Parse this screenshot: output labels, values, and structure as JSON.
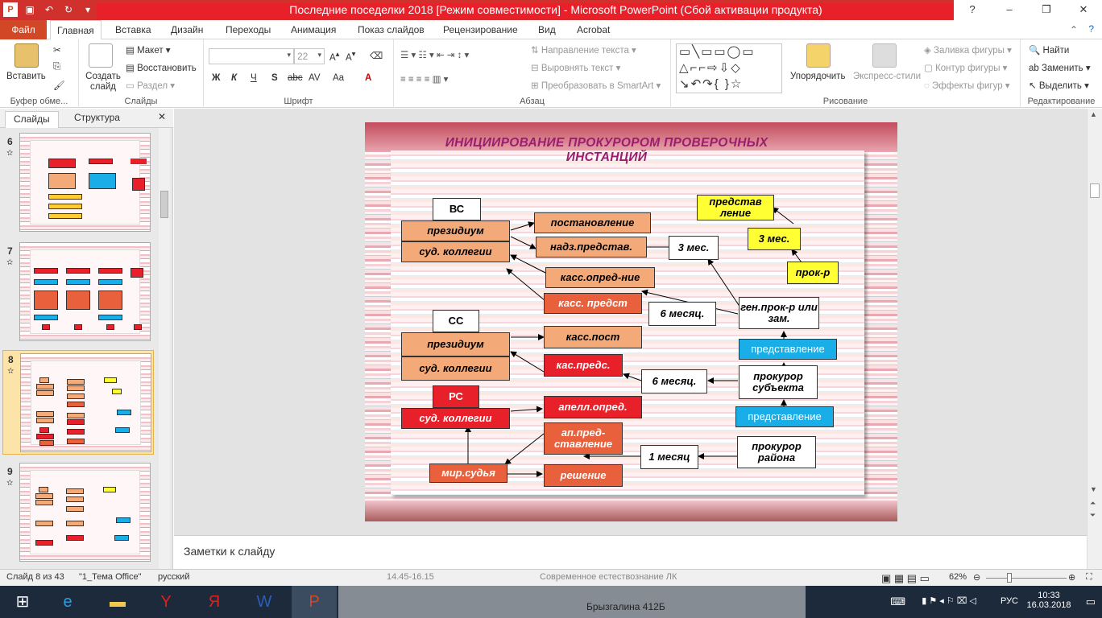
{
  "titlebar": {
    "title": "Последние поседелки 2018 [Режим совместимости] - Microsoft PowerPoint (Сбой активации продукта)"
  },
  "tabs": [
    "Файл",
    "Главная",
    "Вставка",
    "Дизайн",
    "Переходы",
    "Анимация",
    "Показ слайдов",
    "Рецензирование",
    "Вид",
    "Acrobat"
  ],
  "ribbon": {
    "clipboard": {
      "paste": "Вставить",
      "label": "Буфер обме..."
    },
    "slides": {
      "new_slide": "Создать слайд",
      "layout": "Макет",
      "reset": "Восстановить",
      "section": "Раздел",
      "label": "Слайды"
    },
    "font": {
      "size": "22",
      "label": "Шрифт",
      "bold": "Ж",
      "italic": "К",
      "underline": "Ч",
      "strike": "S",
      "shadow": "abc",
      "spacing": "AV",
      "case": "Aa"
    },
    "paragraph": {
      "text_dir": "Направление текста",
      "align_text": "Выровнять текст",
      "smartart": "Преобразовать в SmartArt",
      "label": "Абзац"
    },
    "drawing": {
      "arrange": "Упорядочить",
      "quick_styles": "Экспресс-стили",
      "fill": "Заливка фигуры",
      "outline": "Контур фигуры",
      "effects": "Эффекты фигур",
      "label": "Рисование"
    },
    "editing": {
      "find": "Найти",
      "replace": "Заменить",
      "select": "Выделить",
      "label": "Редактирование"
    }
  },
  "left_panel": {
    "tab_slides": "Слайды",
    "tab_outline": "Структура",
    "thumbs": [
      {
        "num": "6"
      },
      {
        "num": "7"
      },
      {
        "num": "8"
      },
      {
        "num": "9"
      }
    ]
  },
  "slide": {
    "title_line1": "ИНИЦИИРОВАНИЕ   ПРОКУРОРОМ  ПРОВЕРОЧНЫХ",
    "title_line2": "ИНСТАНЦИЙ",
    "vs": "ВС",
    "vs_pres": "президиум",
    "vs_kol": "суд. коллегии",
    "postanov": "постановление",
    "nadz": "надз.представ.",
    "kass_opr": "касс.опред-ние",
    "kass_predst": "касс.  предст",
    "ss": "СС",
    "ss_pres": "президиум",
    "ss_kol": "суд. коллегии",
    "kass_post": "касс.пост",
    "kas_preds": "кас.предс.",
    "rs": "РС",
    "rs_kol": "суд. коллегии",
    "apell": "апелл.опред.",
    "ap_pred": "ап.пред-ставление",
    "reshenie": "решение",
    "mir": "мир.судья",
    "m3_a": "3 мес.",
    "m3_b": "3 мес.",
    "predst_top": "представ ление",
    "prok_r": "прок-р",
    "gen": "ген.прок-р или зам.",
    "m6_a": "6 месяц.",
    "m6_b": "6 месяц.",
    "predst_1": "представление",
    "predst_2": "представление",
    "prok_subj": "прокурор субъекта",
    "prok_rayon": "прокурор района",
    "m1": "1 месяц"
  },
  "notes": "Заметки к слайду",
  "status": {
    "slide": "Слайд 8 из 43",
    "theme": "\"1_Тема Office\"",
    "lang": "русский",
    "zoom": "62%",
    "bg_text_1": "14.45-16.15",
    "bg_text_2": "Современное естествознание ЛК",
    "bg_text_3": "Брызгалина 412Б"
  },
  "tray": {
    "lang": "РУС",
    "time": "10:33",
    "date": "16.03.2018"
  }
}
